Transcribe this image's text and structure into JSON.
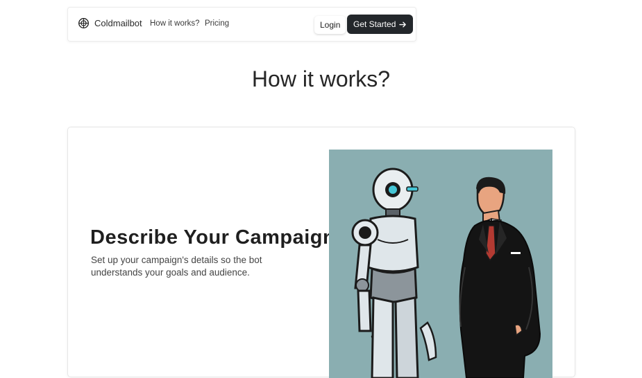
{
  "nav": {
    "brand": "Coldmailbot",
    "brand_icon": "bot-head-icon",
    "links": [
      {
        "label": "How it works?"
      },
      {
        "label": "Pricing"
      }
    ],
    "login_label": "Login",
    "cta_label": "Get Started",
    "cta_icon": "arrow-right-icon"
  },
  "section": {
    "title": "How it works?"
  },
  "feature": {
    "title": "Describe Your Campaign",
    "description": "Set up your campaign's details so the bot understands your goals and audience.",
    "image": "robot-and-businessman-illustration"
  },
  "colors": {
    "cta_background": "#23272b",
    "illustration_background": "#8aaeb1"
  }
}
